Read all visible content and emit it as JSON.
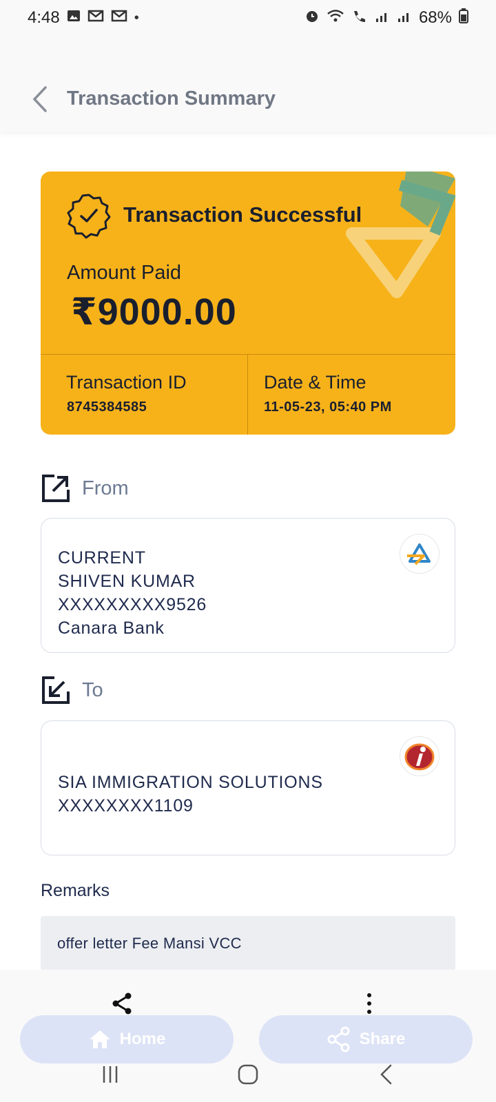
{
  "status_bar": {
    "time": "4:48",
    "battery": "68%"
  },
  "header": {
    "title": "Transaction Summary"
  },
  "card": {
    "status": "Transaction Successful",
    "amount_label": "Amount Paid",
    "amount": "₹9000.00",
    "txn_id_label": "Transaction ID",
    "txn_id": "8745384585",
    "datetime_label": "Date & Time",
    "datetime": "11-05-23, 05:40 PM",
    "color": "#f7b21a"
  },
  "from": {
    "label": "From",
    "lines": [
      "CURRENT",
      "SHIVEN KUMAR",
      "XXXXXXXXX9526",
      "Canara Bank"
    ],
    "logo_icon": "sbi-logo-icon"
  },
  "to": {
    "label": "To",
    "lines": [
      "SIA IMMIGRATION SOLUTIONS",
      "XXXXXXXX1109"
    ],
    "logo_icon": "icici-logo-icon"
  },
  "remarks": {
    "label": "Remarks",
    "text": "offer letter Fee Mansi VCC"
  },
  "actions": {
    "home_label": "Home",
    "share_label": "Share"
  }
}
